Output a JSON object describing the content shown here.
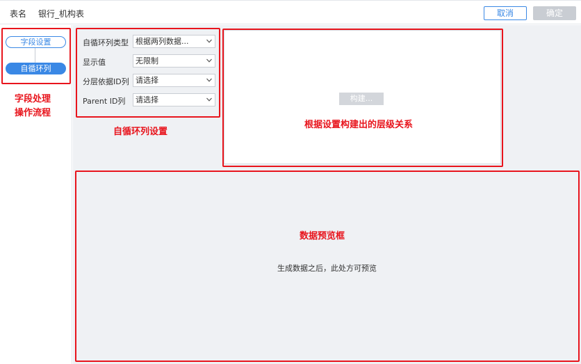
{
  "header": {
    "table_name_label": "表名",
    "table_name_value": "银行_机构表",
    "cancel_label": "取消",
    "confirm_label": "确定"
  },
  "sidebar": {
    "steps": [
      {
        "label": "字段设置"
      },
      {
        "label": "自循环列"
      }
    ]
  },
  "settings": {
    "rows": [
      {
        "label": "自循环列类型",
        "value": "根据两列数据..."
      },
      {
        "label": "显示值",
        "value": "无限制"
      },
      {
        "label": "分层依据ID列",
        "value": "请选择"
      },
      {
        "label": "Parent ID列",
        "value": "请选择"
      }
    ]
  },
  "build": {
    "button_label": "构建..."
  },
  "preview": {
    "empty_text": "生成数据之后，此处方可预览"
  },
  "annotations": {
    "flow": [
      "字段处理",
      "操作流程"
    ],
    "settings": "自循环列设置",
    "hierarchy": "根据设置构建出的层级关系",
    "preview": "数据预览框",
    "color": "#e8141c"
  },
  "colors": {
    "accent": "#3a88e5",
    "disabled": "#c9cdd3",
    "panel_bg": "#eff1f4"
  }
}
